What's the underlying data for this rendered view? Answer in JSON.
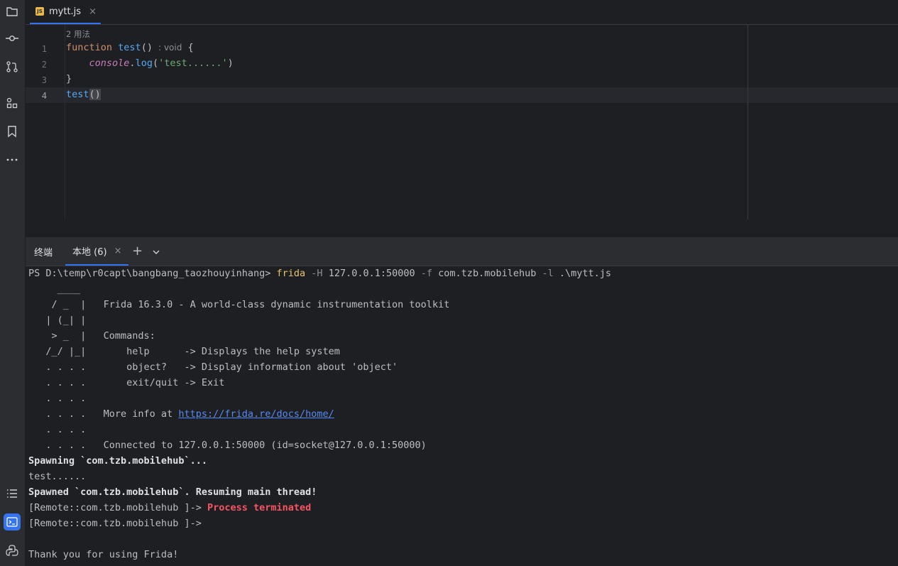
{
  "editor": {
    "tab": {
      "name": "mytt.js",
      "badge": "JS",
      "close": "×"
    },
    "inlay_usages": "2 用法",
    "line_numbers": [
      "1",
      "2",
      "3",
      "4"
    ],
    "code": {
      "l1_kw": "function",
      "l1_fn": "test",
      "l1_paren": "()",
      "l1_hint": ": void",
      "l1_brace": "{",
      "l2_obj": "console",
      "l2_dot": ".",
      "l2_fn": "log",
      "l2_open": "(",
      "l2_str": "'test......'",
      "l2_close": ")",
      "l3": "}",
      "l4_fn": "test",
      "l4_paren": "()"
    }
  },
  "terminal": {
    "title": "终端",
    "tab_label": "本地 (6)",
    "tab_close": "×",
    "add": "+",
    "prompt": "PS D:\\temp\\r0capt\\bangbang_taozhouyinhang>",
    "cmd_name": "frida",
    "cmd_h": "-H",
    "cmd_host": "127.0.0.1:50000",
    "cmd_f": "-f",
    "cmd_pkg": "com.tzb.mobilehub",
    "cmd_l": "-l",
    "cmd_file": ".\\mytt.js",
    "banner": [
      "     ____",
      "    / _  |   Frida 16.3.0 - A world-class dynamic instrumentation toolkit",
      "   | (_| |",
      "    > _  |   Commands:",
      "   /_/ |_|       help      -> Displays the help system",
      "   . . . .       object?   -> Display information about 'object'",
      "   . . . .       exit/quit -> Exit",
      "   . . . .",
      "   . . . .   More info at ",
      "   . . . .",
      "   . . . .   Connected to 127.0.0.1:50000 (id=socket@127.0.0.1:50000)"
    ],
    "more_info_link": "https://frida.re/docs/home/",
    "spawning": "Spawning `com.tzb.mobilehub`...",
    "test_out": "test......",
    "spawned": "Spawned `com.tzb.mobilehub`. Resuming main thread!",
    "remote_prompt": "[Remote::com.tzb.mobilehub ]->",
    "terminated": "Process terminated",
    "thanks": "Thank you for using Frida!"
  }
}
